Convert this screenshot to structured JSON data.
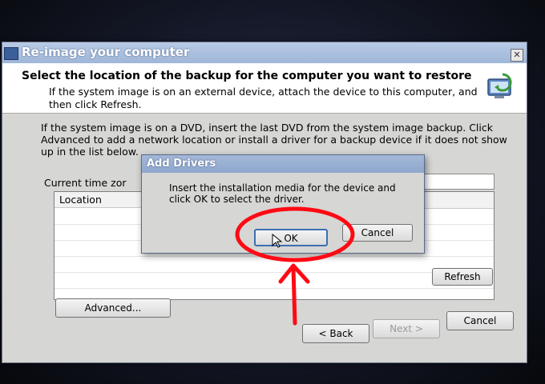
{
  "window": {
    "title": "Re-image your computer",
    "close_glyph": "✕"
  },
  "header": {
    "title": "Select the location of the backup for the computer you want to restore",
    "subtitle": "If the system image is on an external device, attach the device to this computer, and then click Refresh.",
    "icon": "backup-restore-icon"
  },
  "body": {
    "instructions": "If the system image is on a DVD, insert the last DVD from the system image backup. Click Advanced to add a network location or install a driver for a backup device if it does not show up in the list below.",
    "timezone_label": "Current time zor",
    "table": {
      "columns": [
        "Location"
      ],
      "rows": []
    }
  },
  "buttons": {
    "refresh": "Refresh",
    "advanced": "Advanced...",
    "back": "< Back",
    "next": "Next >",
    "cancel": "Cancel"
  },
  "dialog": {
    "title": "Add Drivers",
    "message": "Insert the installation media for the device and click OK to select the driver.",
    "ok": "OK",
    "cancel": "Cancel"
  },
  "annotation": {
    "color": "#ff0a14",
    "type": "circle-and-arrow",
    "target": "ok-button"
  },
  "colors": {
    "titlebar": "#9fb6d8",
    "window_bg": "#d6d6d4",
    "header_bg": "#ffffff"
  }
}
